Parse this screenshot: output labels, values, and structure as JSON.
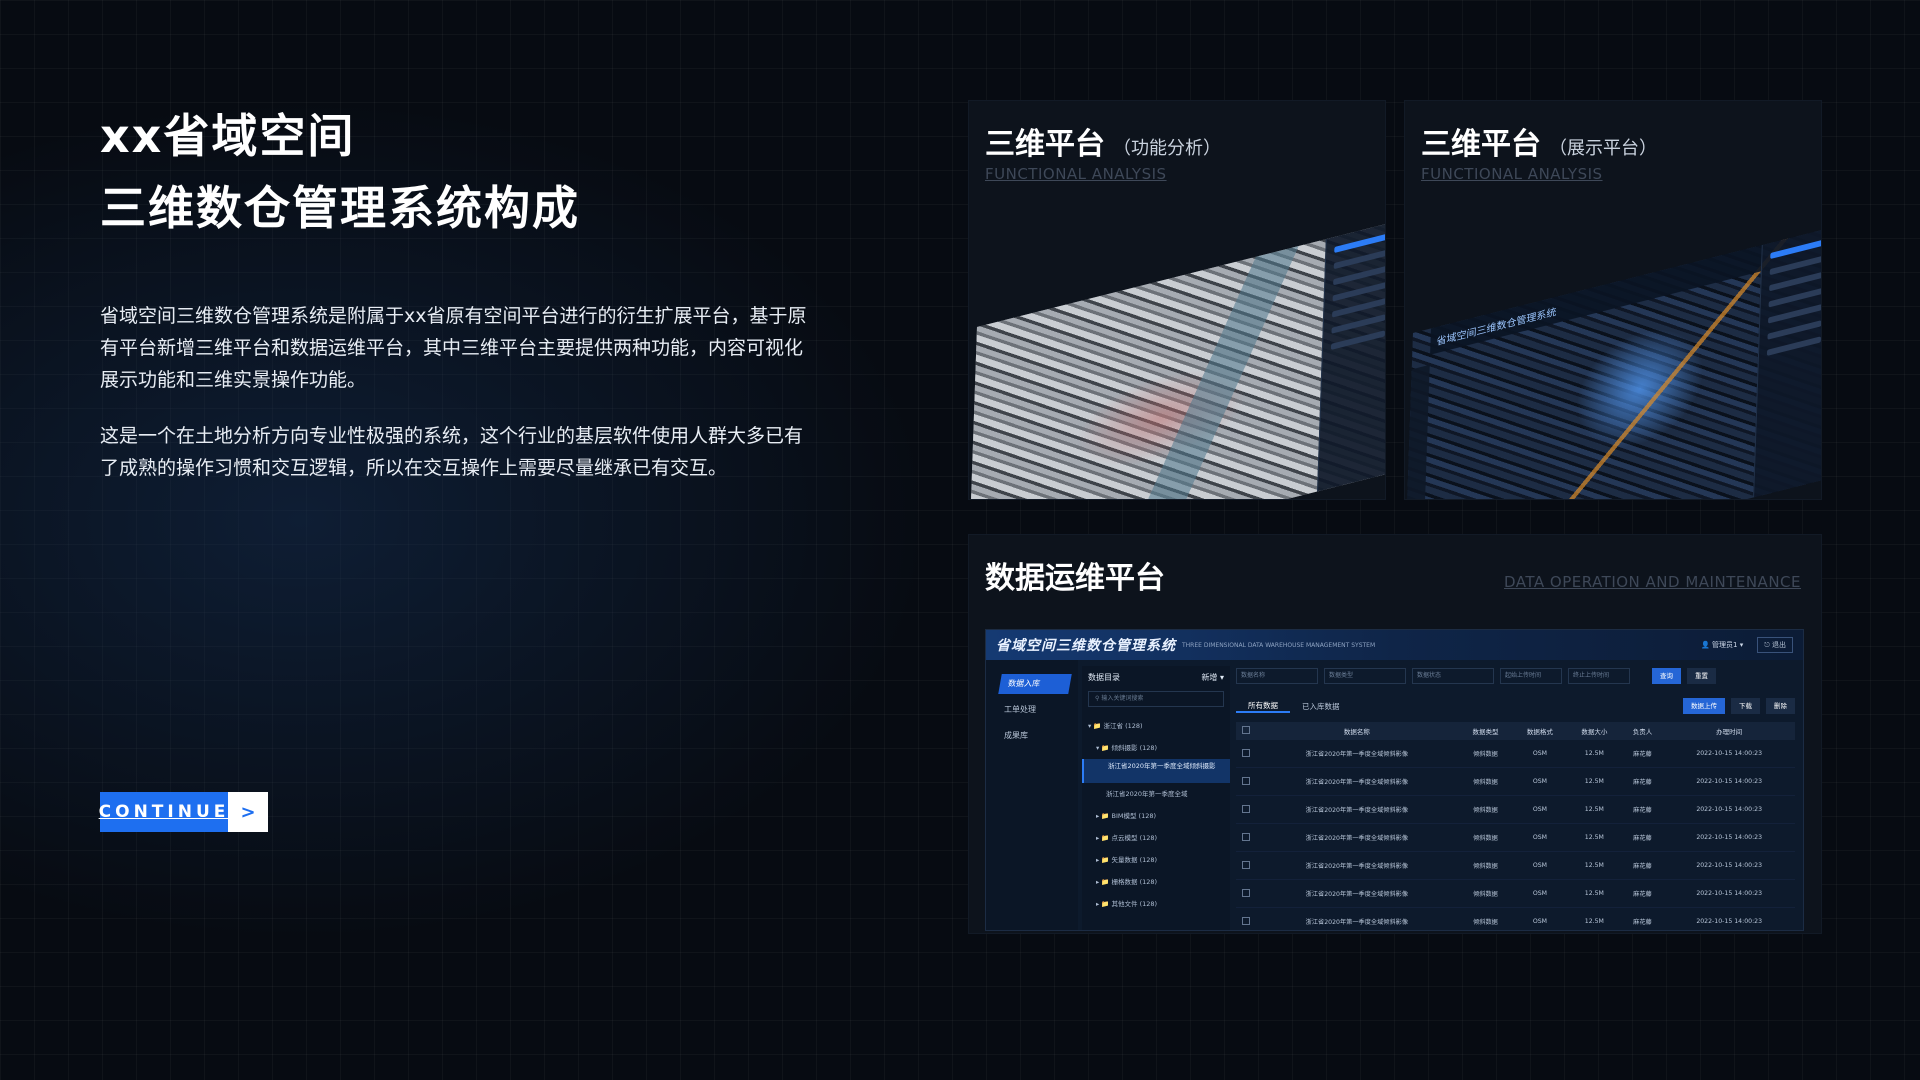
{
  "headline": {
    "line1": "xx省域空间",
    "line2": "三维数仓管理系统构成"
  },
  "paragraphs": [
    "省域空间三维数仓管理系统是附属于xx省原有空间平台进行的衍生扩展平台，基于原有平台新增三维平台和数据运维平台，其中三维平台主要提供两种功能，内容可视化展示功能和三维实景操作功能。",
    "这是一个在土地分析方向专业性极强的系统，这个行业的基层软件使用人群大多已有了成熟的操作习惯和交互逻辑，所以在交互操作上需要尽量继承已有交互。"
  ],
  "cta": {
    "label": "CONTINUE",
    "arrow": ">"
  },
  "cards": {
    "analysis": {
      "title": "三维平台",
      "subtitle": "（功能分析）",
      "en": "FUNCTIONAL ANALYSIS"
    },
    "display": {
      "title": "三维平台",
      "subtitle": "（展示平台）",
      "en": "FUNCTIONAL ANALYSIS",
      "screen_header": "省域空间三维数仓管理系统"
    },
    "ops": {
      "title": "数据运维平台",
      "en": "DATA OPERATION AND MAINTENANCE"
    }
  },
  "ops_ui": {
    "brand": "省域空间三维数仓管理系统",
    "brand_en": "THREE DIMENSIONAL DATA WAREHOUSE MANAGEMENT SYSTEM",
    "user": "管理员1",
    "exit": "退出",
    "nav": [
      "数据入库",
      "工单处理",
      "成果库"
    ],
    "tree_title": "数据目录",
    "tree_action": "新增",
    "tree_search_placeholder": "输入关键词搜索",
    "tree": [
      "浙江省 (128)",
      "倾斜摄影 (128)",
      "浙江省2020年第一季度全域倾斜摄影",
      "浙江省2020年第一季度全域",
      "BIM模型 (128)",
      "点云模型 (128)",
      "矢量数据 (128)",
      "栅格数据 (128)",
      "其他文件 (128)"
    ],
    "filters": [
      "数据名称",
      "数据类型",
      "数据状态",
      "起始上传时间",
      "终止上传时间"
    ],
    "search_btn": "查询",
    "reset_btn": "重置",
    "tabs": [
      "所有数据",
      "已入库数据"
    ],
    "upload_btn": "数据上传",
    "download_btn": "下载",
    "delete_btn": "删除",
    "columns": [
      "数据名称",
      "数据类型",
      "数据格式",
      "数据大小",
      "负责人",
      "办理时间"
    ],
    "row": [
      "浙江省2020年第一季度全域倾斜影像",
      "倾斜数据",
      "OSM",
      "12.5M",
      "麻花藤",
      "2022-10-15 14:00:23"
    ]
  },
  "colors": {
    "accent": "#1e6ff0",
    "background": "#070b12"
  }
}
